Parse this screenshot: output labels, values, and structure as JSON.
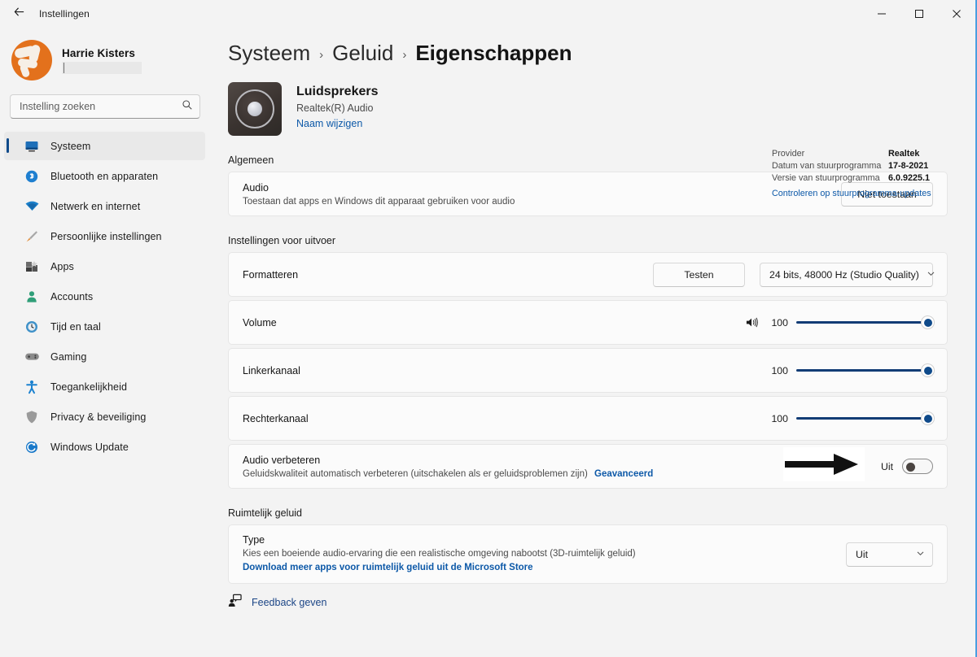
{
  "titlebar": {
    "back_icon": "back-arrow-icon",
    "title": "Instellingen",
    "minimize_label": "—",
    "maximize_label": "□",
    "close_label": "✕"
  },
  "sidebar": {
    "profile": {
      "name": "Harrie Kisters",
      "email_redacted": ""
    },
    "search": {
      "placeholder": "Instelling zoeken",
      "value": "",
      "icon": "search-icon"
    },
    "items": [
      {
        "label": "Systeem",
        "icon": "monitor-icon",
        "active": true
      },
      {
        "label": "Bluetooth en apparaten",
        "icon": "bluetooth-icon",
        "active": false
      },
      {
        "label": "Netwerk en internet",
        "icon": "wifi-icon",
        "active": false
      },
      {
        "label": "Persoonlijke instellingen",
        "icon": "paintbrush-icon",
        "active": false
      },
      {
        "label": "Apps",
        "icon": "apps-icon",
        "active": false
      },
      {
        "label": "Accounts",
        "icon": "person-icon",
        "active": false
      },
      {
        "label": "Tijd en taal",
        "icon": "clock-globe-icon",
        "active": false
      },
      {
        "label": "Gaming",
        "icon": "gamepad-icon",
        "active": false
      },
      {
        "label": "Toegankelijkheid",
        "icon": "accessibility-icon",
        "active": false
      },
      {
        "label": "Privacy & beveiliging",
        "icon": "shield-icon",
        "active": false
      },
      {
        "label": "Windows Update",
        "icon": "update-icon",
        "active": false
      }
    ]
  },
  "breadcrumb": {
    "items": [
      "Systeem",
      "Geluid",
      "Eigenschappen"
    ],
    "separator": "›"
  },
  "device": {
    "name": "Luidsprekers",
    "subtitle": "Realtek(R) Audio",
    "rename_link": "Naam wijzigen",
    "icon": "speaker-icon"
  },
  "driver_info": {
    "rows": [
      {
        "key": "Provider",
        "value": "Realtek"
      },
      {
        "key": "Datum van stuurprogramma",
        "value": "17-8-2021"
      },
      {
        "key": "Versie van stuurprogramma",
        "value": "6.0.9225.1"
      }
    ],
    "update_link": "Controleren op stuurprogramma-updates"
  },
  "sections": {
    "algemeen": {
      "title": "Algemeen",
      "audio": {
        "title": "Audio",
        "subtitle": "Toestaan dat apps en Windows dit apparaat gebruiken voor audio",
        "button": "Niet toestaan"
      }
    },
    "uitvoer": {
      "title": "Instellingen voor uitvoer",
      "formatteren": {
        "title": "Formatteren",
        "test_button": "Testen",
        "format_value": "24 bits, 48000 Hz (Studio Quality)",
        "chevron": "chevron-down-icon"
      },
      "volume": {
        "title": "Volume",
        "value": "100",
        "icon": "speaker-wave-icon"
      },
      "linkerkanaal": {
        "title": "Linkerkanaal",
        "value": "100"
      },
      "rechterkanaal": {
        "title": "Rechterkanaal",
        "value": "100"
      },
      "audio_verbeteren": {
        "title": "Audio verbeteren",
        "subtitle": "Geluidskwaliteit automatisch verbeteren (uitschakelen als er geluidsproblemen zijn)",
        "advanced_link": "Geavanceerd",
        "toggle_label": "Uit",
        "toggle_on": false,
        "annotation_icon": "arrow-right-annotation"
      }
    },
    "ruimtelijk": {
      "title": "Ruimtelijk geluid",
      "type": {
        "title": "Type",
        "subtitle": "Kies een boeiende audio-ervaring die een realistische omgeving nabootst (3D-ruimtelijk geluid)",
        "store_link": "Download meer apps voor ruimtelijk geluid uit de Microsoft Store",
        "value": "Uit",
        "chevron": "chevron-down-icon"
      }
    }
  },
  "footer": {
    "feedback_label": "Feedback geven",
    "icon": "feedback-icon"
  },
  "colors": {
    "accent": "#0f4a8a",
    "link": "#0d59a8",
    "slider_track": "#123c75",
    "window_border": "#4a9ee0",
    "avatar": "#e3711c"
  }
}
